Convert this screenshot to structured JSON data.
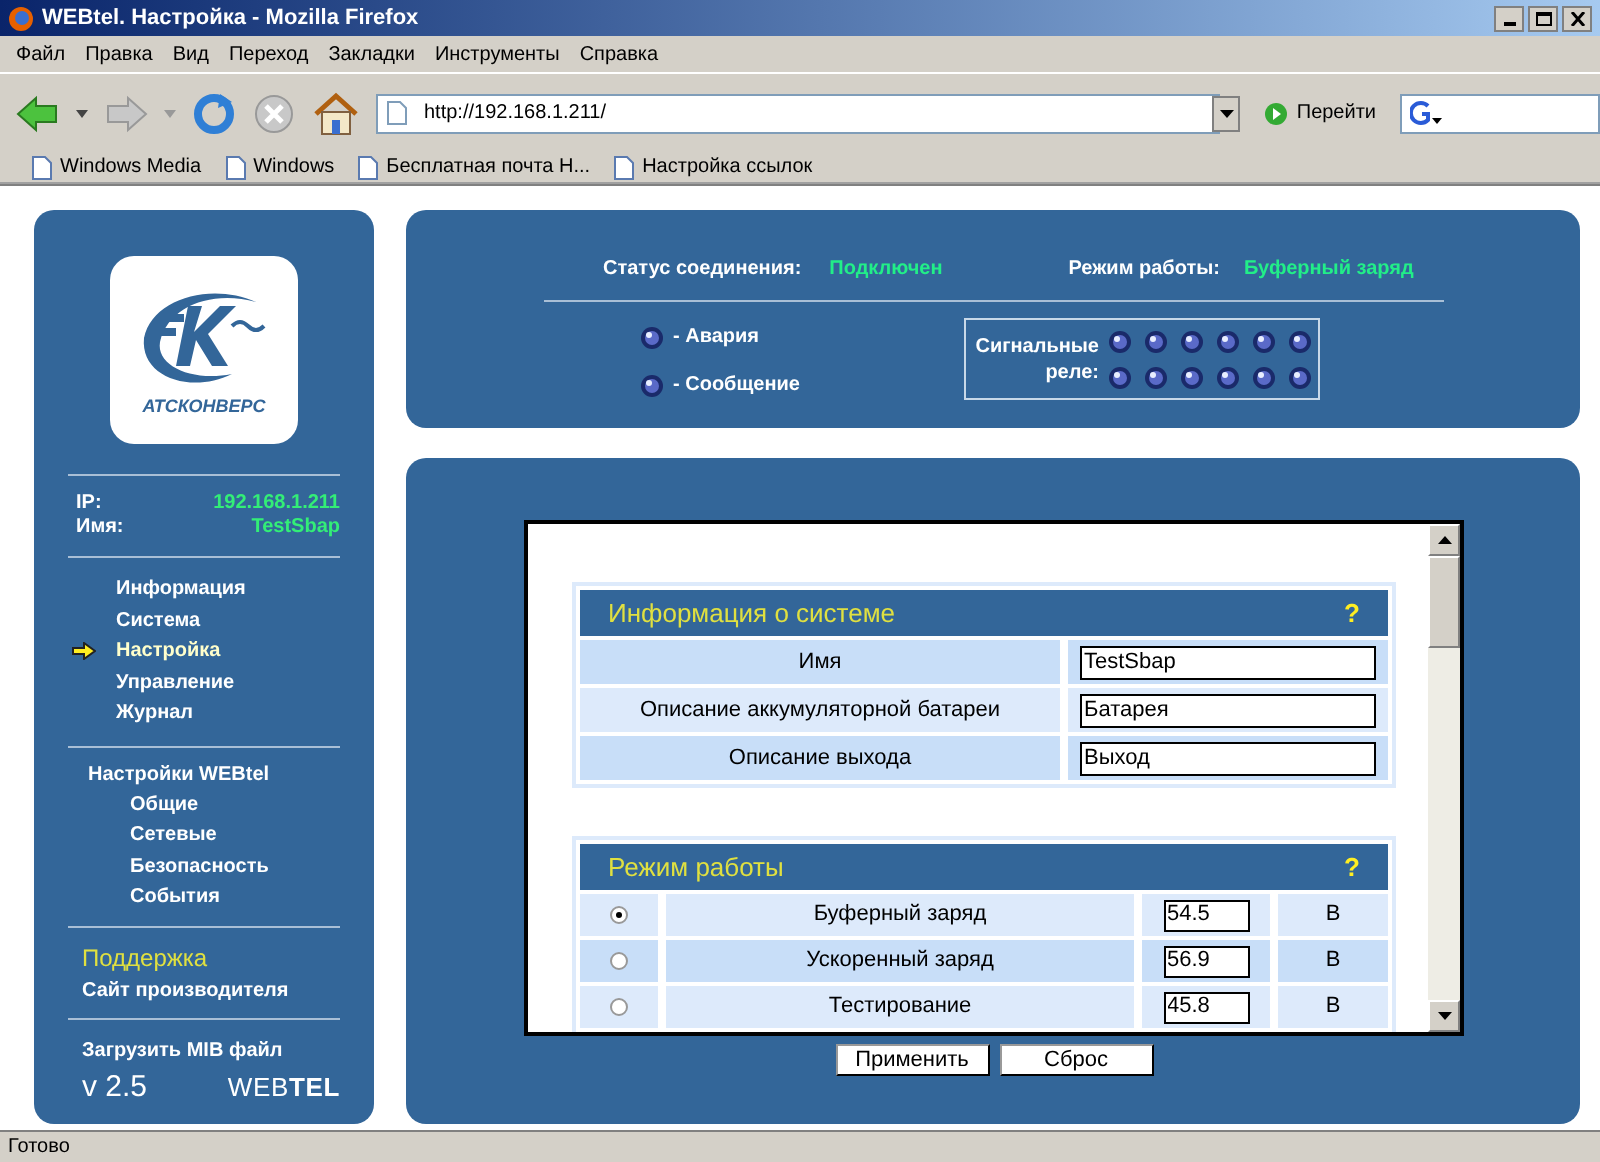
{
  "window": {
    "title": "WEBtel. Настройка - Mozilla Firefox"
  },
  "menu": [
    "Файл",
    "Правка",
    "Вид",
    "Переход",
    "Закладки",
    "Инструменты",
    "Справка"
  ],
  "toolbar": {
    "url": "http://192.168.1.211/",
    "go": "Перейти"
  },
  "bookmarks": [
    "Windows Media",
    "Windows",
    "Бесплатная почта H...",
    "Настройка ссылок"
  ],
  "sidebar": {
    "logo_text": "АТСКОНВЕРС",
    "info": [
      {
        "label": "IP:",
        "value": "192.168.1.211"
      },
      {
        "label": "Имя:",
        "value": "TestSbap"
      }
    ],
    "nav": [
      {
        "label": "Информация",
        "selected": false
      },
      {
        "label": "Система",
        "selected": false
      },
      {
        "label": "Настройка",
        "selected": true
      },
      {
        "label": "Управление",
        "selected": false
      },
      {
        "label": "Журнал",
        "selected": false
      }
    ],
    "settings": {
      "label": "Настройки WEBtel",
      "children": [
        "Общие",
        "Сетевые",
        "Безопасность",
        "События"
      ]
    },
    "support": {
      "heading": "Поддержка",
      "link": "Сайт производителя"
    },
    "mib": "Загрузить MIB файл",
    "version": "v 2.5",
    "brand": "WEB**TEL**"
  },
  "status": {
    "connection_label": "Статус соединения:",
    "connection_value": "Подключен",
    "mode_label": "Режим работы:",
    "mode_value": "Буферный заряд",
    "legend": [
      "- Авария",
      "- Сообщение"
    ],
    "relays_label": "Сигнальные реле:"
  },
  "system_info": {
    "title": "Информация о системе",
    "help": "?",
    "rows": [
      {
        "label": "Имя",
        "value": "TestSbap"
      },
      {
        "label": "Описание аккумуляторной батареи",
        "value": "Батарея"
      },
      {
        "label": "Описание выхода",
        "value": "Выход"
      }
    ]
  },
  "work_mode": {
    "title": "Режим работы",
    "help": "?",
    "rows": [
      {
        "label": "Буферный заряд",
        "value": "54.5",
        "unit": "В",
        "selected": true
      },
      {
        "label": "Ускоренный заряд",
        "value": "56.9",
        "unit": "В",
        "selected": false
      },
      {
        "label": "Тестирование",
        "value": "45.8",
        "unit": "В",
        "selected": false
      }
    ]
  },
  "buttons": [
    "Применить",
    "Сброс"
  ],
  "status_bar": "Готово"
}
